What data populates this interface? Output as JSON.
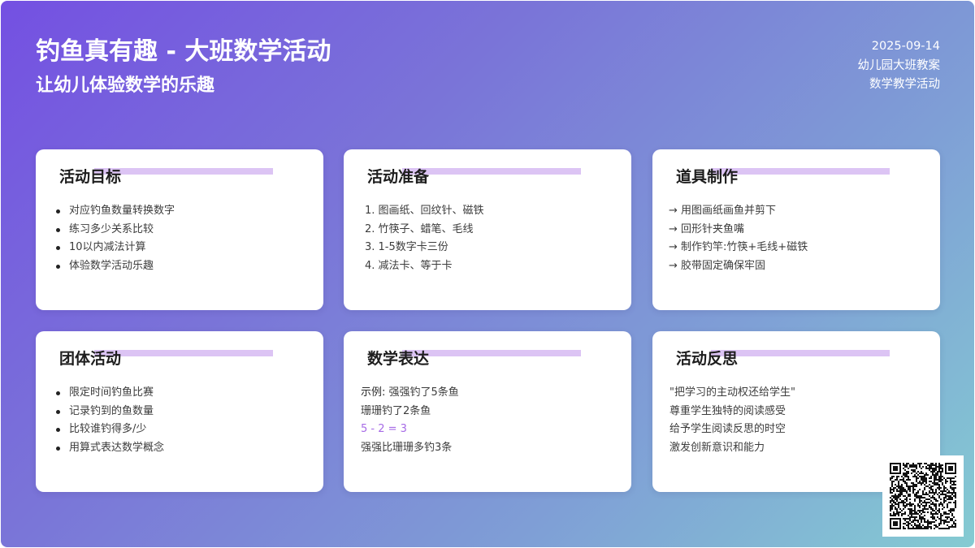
{
  "header": {
    "title": "钓鱼真有趣 - 大班数学活动",
    "subtitle": "让幼儿体验数学的乐趣",
    "date": "2025-09-14",
    "meta_line1": "幼儿园大班教案",
    "meta_line2": "数学教学活动"
  },
  "cards": [
    {
      "title": "活动目标",
      "items": [
        "对应钓鱼数量转换数字",
        "练习多少关系比较",
        "10以内减法计算",
        "体验数学活动乐趣"
      ]
    },
    {
      "title": "活动准备",
      "items": [
        "1. 图画纸、回纹针、磁铁",
        "2. 竹筷子、蜡笔、毛线",
        "3. 1-5数字卡三份",
        "4. 减法卡、等于卡"
      ]
    },
    {
      "title": "道具制作",
      "items": [
        "→ 用图画纸画鱼并剪下",
        "→ 回形针夹鱼嘴",
        "→ 制作钓竿:竹筷+毛线+磁铁",
        "→ 胶带固定确保牢固"
      ]
    },
    {
      "title": "团体活动",
      "items": [
        "限定时间钓鱼比赛",
        "记录钓到的鱼数量",
        "比较谁钓得多/少",
        "用算式表达数学概念"
      ]
    },
    {
      "title": "数学表达",
      "example_label": "示例:",
      "items": [
        "强强钓了5条鱼",
        "珊珊钓了2条鱼",
        "5 - 2 = 3",
        "强强比珊珊多钓3条"
      ]
    },
    {
      "title": "活动反思",
      "items": [
        "\"把学习的主动权还给学生\"",
        "尊重学生独特的阅读感受",
        "给予学生阅读反思的时空",
        "激发创新意识和能力"
      ]
    }
  ],
  "colors": {
    "accent_bar": "#dcc4f4",
    "formula": "#a66ae6",
    "gradient_start": "#7450e2",
    "gradient_end": "#84cbd2"
  },
  "qr_code": {
    "icon": "qr-code-icon"
  }
}
